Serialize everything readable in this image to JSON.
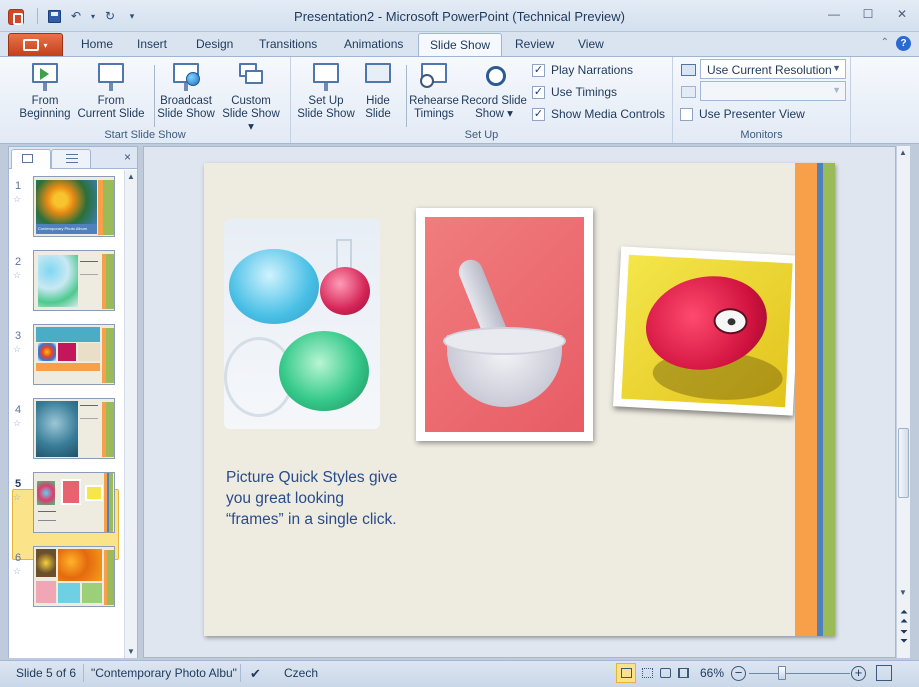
{
  "window": {
    "title": "Presentation2  -  Microsoft PowerPoint (Technical Preview)"
  },
  "qat": {
    "save_icon": "save-icon",
    "undo_icon": "undo-icon",
    "redo_icon": "redo-icon"
  },
  "tabs": [
    "Home",
    "Insert",
    "Design",
    "Transitions",
    "Animations",
    "Slide Show",
    "Review",
    "View"
  ],
  "active_tab": "Slide Show",
  "ribbon": {
    "start": {
      "label": "Start Slide Show",
      "from_beginning": [
        "From",
        "Beginning"
      ],
      "from_current": [
        "From",
        "Current Slide"
      ],
      "broadcast": [
        "Broadcast",
        "Slide Show"
      ],
      "custom": [
        "Custom",
        "Slide Show ▾"
      ]
    },
    "setup": {
      "label": "Set Up",
      "setup_show": [
        "Set Up",
        "Slide Show"
      ],
      "hide_slide": [
        "Hide",
        "Slide"
      ],
      "rehearse": [
        "Rehearse",
        "Timings"
      ],
      "record": [
        "Record Slide",
        "Show ▾"
      ],
      "play_narrations": "Play Narrations",
      "use_timings": "Use Timings",
      "show_media_controls": "Show Media Controls"
    },
    "monitors": {
      "label": "Monitors",
      "resolution": "Use Current Resolution",
      "show_on": "",
      "presenter_view": "Use Presenter View"
    }
  },
  "thumbnails": [
    {
      "num": "1",
      "caption": "Contemporary Photo Album"
    },
    {
      "num": "2",
      "caption": ""
    },
    {
      "num": "3",
      "caption": ""
    },
    {
      "num": "4",
      "caption": ""
    },
    {
      "num": "5",
      "caption": ""
    },
    {
      "num": "6",
      "caption": ""
    }
  ],
  "slide": {
    "text": "Picture Quick Styles give you great looking “frames” in a single click.",
    "stripes": [
      "#f7a049",
      "#4f81bd",
      "#9bbb59"
    ]
  },
  "status": {
    "slide_of": "Slide 5 of 6",
    "theme": "\"Contemporary Photo Albu\"",
    "language": "Czech",
    "zoom": "66%"
  }
}
